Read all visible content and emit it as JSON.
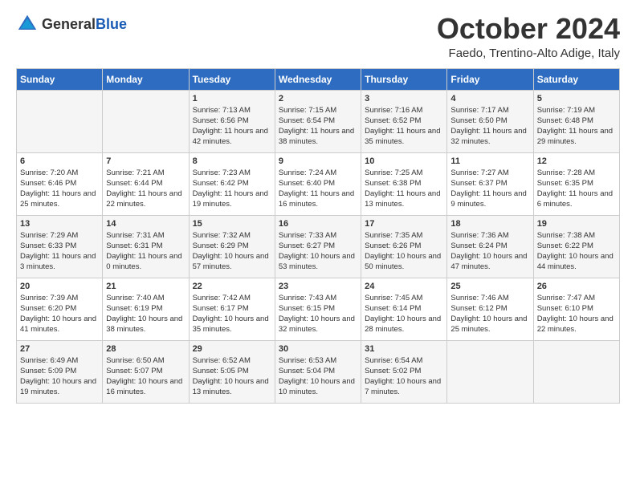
{
  "header": {
    "logo_general": "General",
    "logo_blue": "Blue",
    "month": "October 2024",
    "location": "Faedo, Trentino-Alto Adige, Italy"
  },
  "days_of_week": [
    "Sunday",
    "Monday",
    "Tuesday",
    "Wednesday",
    "Thursday",
    "Friday",
    "Saturday"
  ],
  "weeks": [
    [
      {
        "day": "",
        "content": ""
      },
      {
        "day": "",
        "content": ""
      },
      {
        "day": "1",
        "content": "Sunrise: 7:13 AM\nSunset: 6:56 PM\nDaylight: 11 hours and 42 minutes."
      },
      {
        "day": "2",
        "content": "Sunrise: 7:15 AM\nSunset: 6:54 PM\nDaylight: 11 hours and 38 minutes."
      },
      {
        "day": "3",
        "content": "Sunrise: 7:16 AM\nSunset: 6:52 PM\nDaylight: 11 hours and 35 minutes."
      },
      {
        "day": "4",
        "content": "Sunrise: 7:17 AM\nSunset: 6:50 PM\nDaylight: 11 hours and 32 minutes."
      },
      {
        "day": "5",
        "content": "Sunrise: 7:19 AM\nSunset: 6:48 PM\nDaylight: 11 hours and 29 minutes."
      }
    ],
    [
      {
        "day": "6",
        "content": "Sunrise: 7:20 AM\nSunset: 6:46 PM\nDaylight: 11 hours and 25 minutes."
      },
      {
        "day": "7",
        "content": "Sunrise: 7:21 AM\nSunset: 6:44 PM\nDaylight: 11 hours and 22 minutes."
      },
      {
        "day": "8",
        "content": "Sunrise: 7:23 AM\nSunset: 6:42 PM\nDaylight: 11 hours and 19 minutes."
      },
      {
        "day": "9",
        "content": "Sunrise: 7:24 AM\nSunset: 6:40 PM\nDaylight: 11 hours and 16 minutes."
      },
      {
        "day": "10",
        "content": "Sunrise: 7:25 AM\nSunset: 6:38 PM\nDaylight: 11 hours and 13 minutes."
      },
      {
        "day": "11",
        "content": "Sunrise: 7:27 AM\nSunset: 6:37 PM\nDaylight: 11 hours and 9 minutes."
      },
      {
        "day": "12",
        "content": "Sunrise: 7:28 AM\nSunset: 6:35 PM\nDaylight: 11 hours and 6 minutes."
      }
    ],
    [
      {
        "day": "13",
        "content": "Sunrise: 7:29 AM\nSunset: 6:33 PM\nDaylight: 11 hours and 3 minutes."
      },
      {
        "day": "14",
        "content": "Sunrise: 7:31 AM\nSunset: 6:31 PM\nDaylight: 11 hours and 0 minutes."
      },
      {
        "day": "15",
        "content": "Sunrise: 7:32 AM\nSunset: 6:29 PM\nDaylight: 10 hours and 57 minutes."
      },
      {
        "day": "16",
        "content": "Sunrise: 7:33 AM\nSunset: 6:27 PM\nDaylight: 10 hours and 53 minutes."
      },
      {
        "day": "17",
        "content": "Sunrise: 7:35 AM\nSunset: 6:26 PM\nDaylight: 10 hours and 50 minutes."
      },
      {
        "day": "18",
        "content": "Sunrise: 7:36 AM\nSunset: 6:24 PM\nDaylight: 10 hours and 47 minutes."
      },
      {
        "day": "19",
        "content": "Sunrise: 7:38 AM\nSunset: 6:22 PM\nDaylight: 10 hours and 44 minutes."
      }
    ],
    [
      {
        "day": "20",
        "content": "Sunrise: 7:39 AM\nSunset: 6:20 PM\nDaylight: 10 hours and 41 minutes."
      },
      {
        "day": "21",
        "content": "Sunrise: 7:40 AM\nSunset: 6:19 PM\nDaylight: 10 hours and 38 minutes."
      },
      {
        "day": "22",
        "content": "Sunrise: 7:42 AM\nSunset: 6:17 PM\nDaylight: 10 hours and 35 minutes."
      },
      {
        "day": "23",
        "content": "Sunrise: 7:43 AM\nSunset: 6:15 PM\nDaylight: 10 hours and 32 minutes."
      },
      {
        "day": "24",
        "content": "Sunrise: 7:45 AM\nSunset: 6:14 PM\nDaylight: 10 hours and 28 minutes."
      },
      {
        "day": "25",
        "content": "Sunrise: 7:46 AM\nSunset: 6:12 PM\nDaylight: 10 hours and 25 minutes."
      },
      {
        "day": "26",
        "content": "Sunrise: 7:47 AM\nSunset: 6:10 PM\nDaylight: 10 hours and 22 minutes."
      }
    ],
    [
      {
        "day": "27",
        "content": "Sunrise: 6:49 AM\nSunset: 5:09 PM\nDaylight: 10 hours and 19 minutes."
      },
      {
        "day": "28",
        "content": "Sunrise: 6:50 AM\nSunset: 5:07 PM\nDaylight: 10 hours and 16 minutes."
      },
      {
        "day": "29",
        "content": "Sunrise: 6:52 AM\nSunset: 5:05 PM\nDaylight: 10 hours and 13 minutes."
      },
      {
        "day": "30",
        "content": "Sunrise: 6:53 AM\nSunset: 5:04 PM\nDaylight: 10 hours and 10 minutes."
      },
      {
        "day": "31",
        "content": "Sunrise: 6:54 AM\nSunset: 5:02 PM\nDaylight: 10 hours and 7 minutes."
      },
      {
        "day": "",
        "content": ""
      },
      {
        "day": "",
        "content": ""
      }
    ]
  ]
}
